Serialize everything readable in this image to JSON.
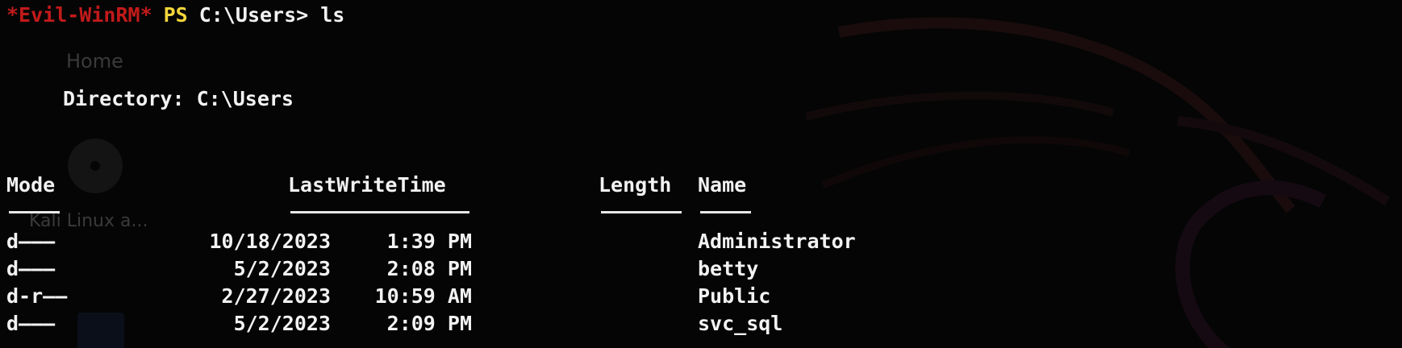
{
  "desktop": {
    "home_label": "Home",
    "kali_label": "Kali Linux a..."
  },
  "prompt": {
    "evil": "*Evil-WinRM*",
    "ps": "PS",
    "path": "C:\\Users>",
    "command": " ls"
  },
  "directory_line": "Directory: C:\\Users",
  "table": {
    "headers": {
      "mode": "Mode",
      "lastwritetime": "LastWriteTime",
      "length": "Length",
      "name": "Name"
    },
    "rows": [
      {
        "mode": "d———",
        "date": "10/18/2023",
        "time": "1:39 PM",
        "length": "",
        "name": "Administrator"
      },
      {
        "mode": "d———",
        "date": "5/2/2023",
        "time": "2:08 PM",
        "length": "",
        "name": "betty"
      },
      {
        "mode": "d-r——",
        "date": "2/27/2023",
        "time": "10:59 AM",
        "length": "",
        "name": "Public"
      },
      {
        "mode": "d———",
        "date": "5/2/2023",
        "time": "2:09 PM",
        "length": "",
        "name": "svc_sql"
      }
    ]
  },
  "colors": {
    "background": "#050505",
    "prompt_evil": "#c21a1a",
    "prompt_ps": "#f2d53c",
    "text": "#f2f2f2"
  }
}
